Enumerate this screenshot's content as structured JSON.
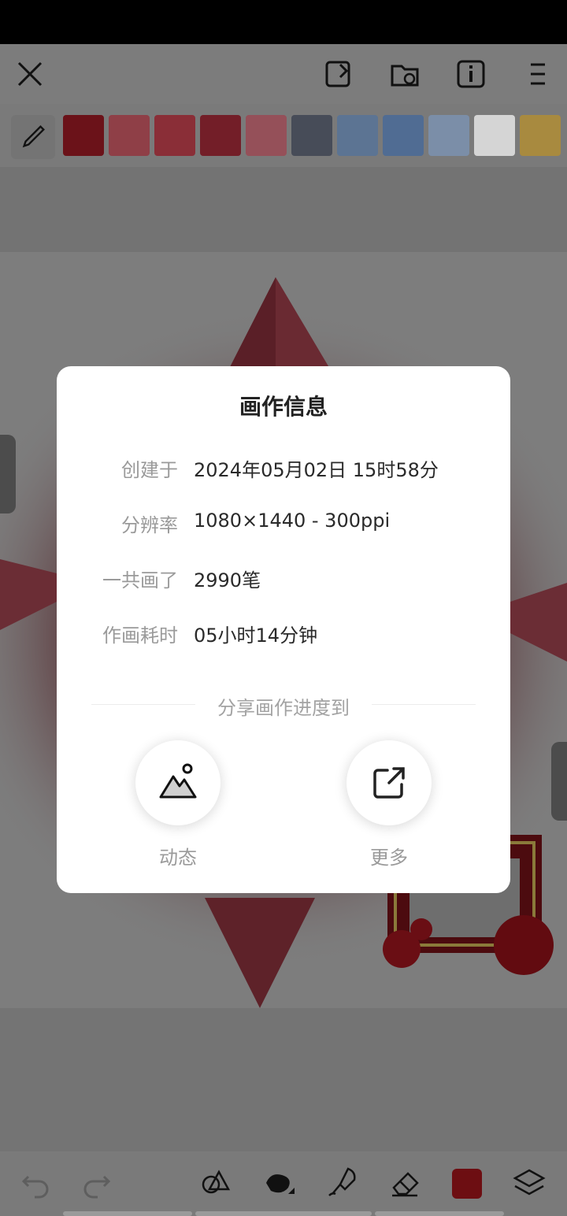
{
  "toolbar": {
    "icons": [
      "close-icon",
      "canvas-edit-icon",
      "cloud-folder-icon",
      "info-icon",
      "menu-icon"
    ]
  },
  "palette": {
    "swatches": [
      "#6b1219",
      "#8f3f47",
      "#8a2e37",
      "#731e28",
      "#955059",
      "#474c58",
      "#5c7493",
      "#506c93",
      "#7b8ea8",
      "#d5d5d5",
      "#a88a3f"
    ]
  },
  "dialog": {
    "title": "画作信息",
    "rows": [
      {
        "label": "创建于",
        "value": "2024年05月02日 15时58分"
      },
      {
        "label": "分辨率",
        "value": "1080×1440 - 300ppi"
      },
      {
        "label": "一共画了",
        "value": "2990笔"
      },
      {
        "label": "作画耗时",
        "value": "05小时14分钟"
      }
    ],
    "share_caption": "分享画作进度到",
    "share": [
      {
        "label": "动态",
        "icon": "mountain-photo-icon"
      },
      {
        "label": "更多",
        "icon": "external-share-icon"
      }
    ]
  },
  "bottom_bar": {
    "icons": [
      "undo-icon",
      "redo-icon",
      "shapes-icon",
      "brush-icon",
      "smudge-icon",
      "eraser-icon",
      "color-icon",
      "layers-icon"
    ],
    "current_color": "#6d0e12"
  }
}
